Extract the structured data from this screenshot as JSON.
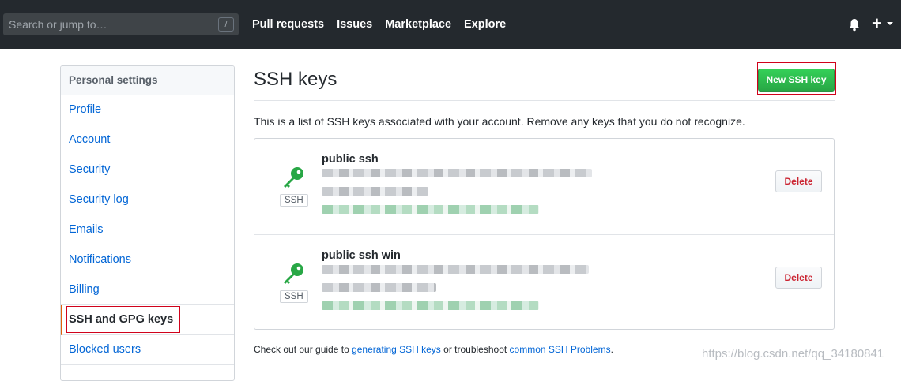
{
  "header": {
    "search_placeholder": "Search or jump to…",
    "search_shortcut": "/",
    "nav": [
      "Pull requests",
      "Issues",
      "Marketplace",
      "Explore"
    ],
    "plus": "+"
  },
  "sidebar": {
    "heading": "Personal settings",
    "items": [
      {
        "label": "Profile"
      },
      {
        "label": "Account"
      },
      {
        "label": "Security"
      },
      {
        "label": "Security log"
      },
      {
        "label": "Emails"
      },
      {
        "label": "Notifications"
      },
      {
        "label": "Billing"
      },
      {
        "label": "SSH and GPG keys"
      },
      {
        "label": "Blocked users"
      }
    ]
  },
  "main": {
    "title": "SSH keys",
    "new_button": "New SSH key",
    "description": "This is a list of SSH keys associated with your account. Remove any keys that you do not recognize.",
    "keys": [
      {
        "title": "public ssh",
        "type_label": "SSH",
        "delete_label": "Delete"
      },
      {
        "title": "public ssh win",
        "type_label": "SSH",
        "delete_label": "Delete"
      }
    ],
    "footer": {
      "prefix": "Check out our guide to ",
      "link1": "generating SSH keys",
      "middle": " or troubleshoot ",
      "link2": "common SSH Problems",
      "suffix": "."
    }
  },
  "watermark": "https://blog.csdn.net/qq_34180841",
  "colors": {
    "accent": "#0366d6",
    "success": "#28a745",
    "danger": "#cb2431",
    "key_icon": "#28a745"
  }
}
